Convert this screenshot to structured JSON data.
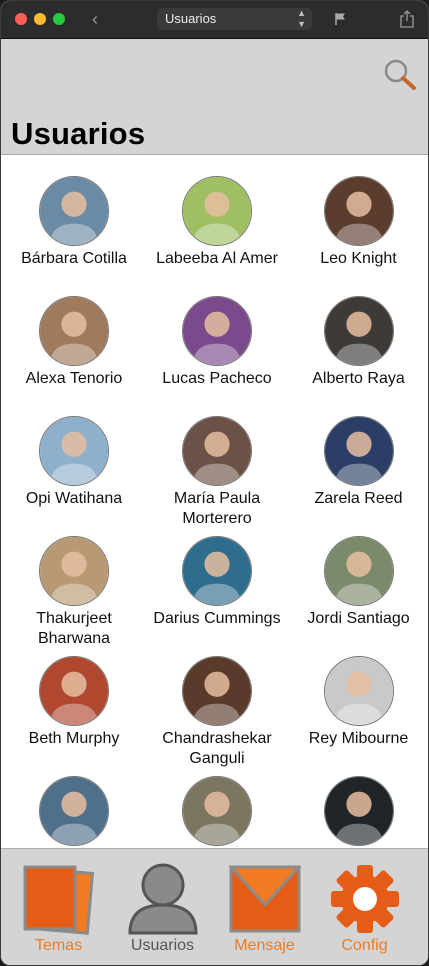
{
  "window": {
    "url_select": "Usuarios"
  },
  "header": {
    "title": "Usuarios"
  },
  "users": [
    {
      "name": "Bárbara Cotilla",
      "color": "#6b8aa3"
    },
    {
      "name": "Labeeba Al Amer",
      "color": "#9ebf62"
    },
    {
      "name": "Leo Knight",
      "color": "#5b3d2e"
    },
    {
      "name": "Alexa Tenorio",
      "color": "#a07a5c"
    },
    {
      "name": "Lucas Pacheco",
      "color": "#7a4a8c"
    },
    {
      "name": "Alberto Raya",
      "color": "#3d3a38"
    },
    {
      "name": "Opi Watihana",
      "color": "#8fb0cc"
    },
    {
      "name": "María Paula Morterero",
      "color": "#6c5246"
    },
    {
      "name": "Zarela Reed",
      "color": "#2b3f66"
    },
    {
      "name": "Thakurjeet Bharwana",
      "color": "#b79a74"
    },
    {
      "name": "Darius Cummings",
      "color": "#2f6d8e"
    },
    {
      "name": "Jordi Santiago",
      "color": "#7b8a6a"
    },
    {
      "name": "Beth Murphy",
      "color": "#b0472f"
    },
    {
      "name": "Chandrashekar Ganguli",
      "color": "#5a3a2a"
    },
    {
      "name": "Rey Mibourne",
      "color": "#c9c9c9"
    },
    {
      "name": "",
      "color": "#4f6f8a"
    },
    {
      "name": "",
      "color": "#7c7560"
    },
    {
      "name": "",
      "color": "#1f2528"
    }
  ],
  "tabs": [
    {
      "label": "Temas",
      "icon": "stacked-cards-icon",
      "color": "#f07b22"
    },
    {
      "label": "Usuarios",
      "icon": "person-icon",
      "color": "#555555"
    },
    {
      "label": "Mensaje",
      "icon": "envelope-icon",
      "color": "#f07b22"
    },
    {
      "label": "Config",
      "icon": "gear-icon",
      "color": "#f07b22"
    }
  ],
  "colors": {
    "accent": "#f07b22",
    "accent_dark": "#e55c16",
    "selected_tab": "#555555",
    "header_bg": "#d4d4d4"
  }
}
